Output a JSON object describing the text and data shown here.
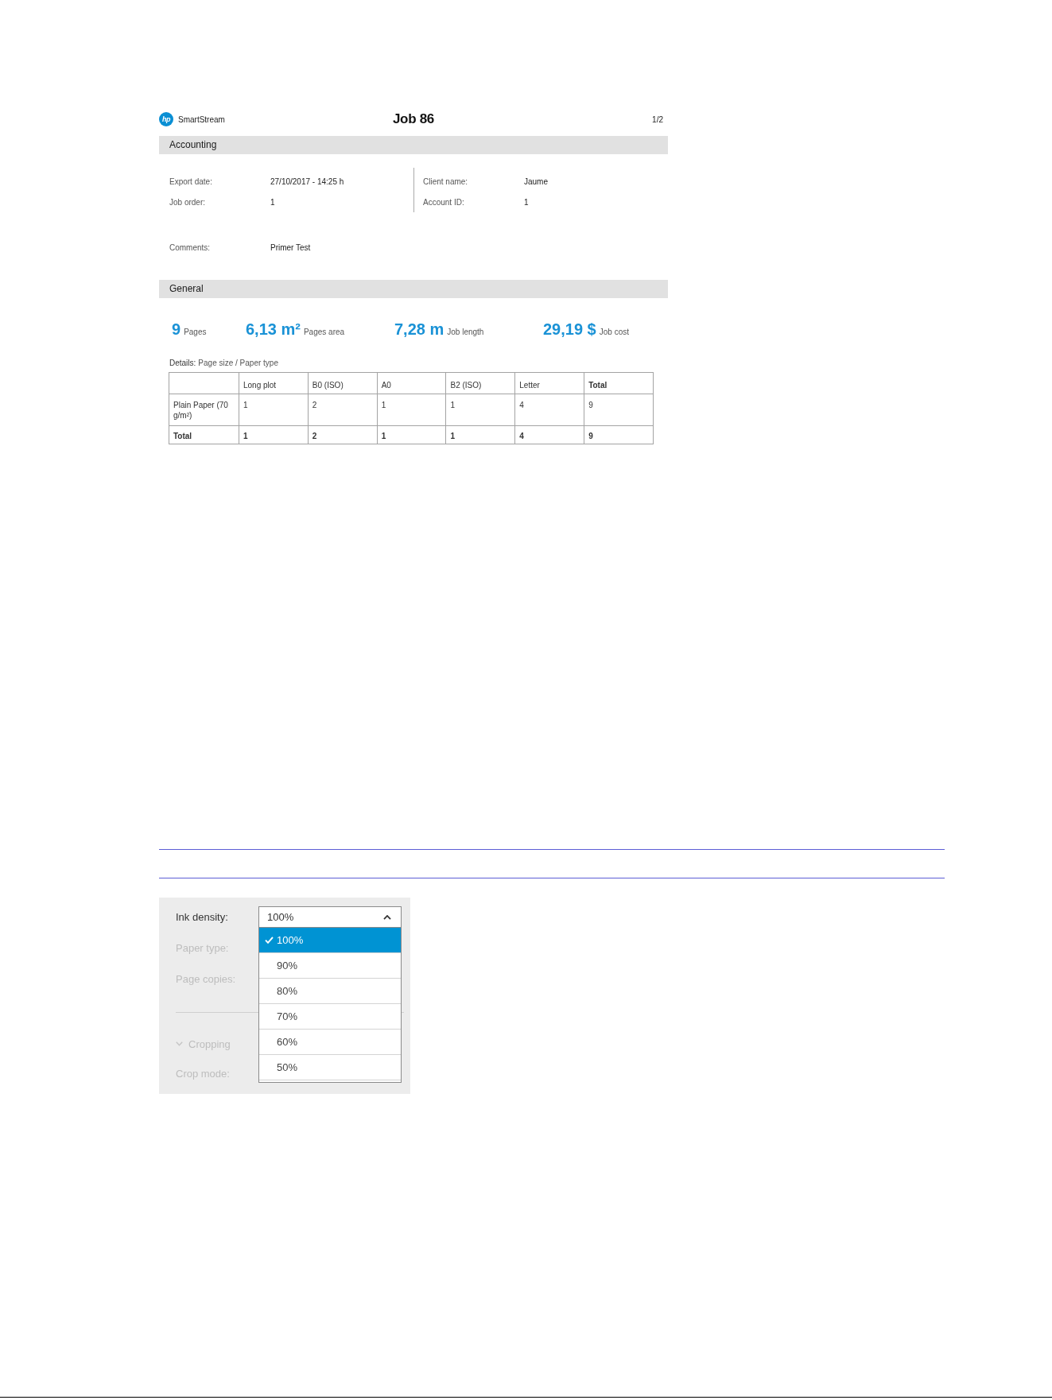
{
  "report": {
    "logo_mark": "hp",
    "brand": "SmartStream",
    "title": "Job 86",
    "page_number": "1/2",
    "accounting": {
      "heading": "Accounting",
      "left_fields": [
        {
          "label": "Export date:",
          "value": "27/10/2017 - 14:25 h"
        },
        {
          "label": "Job order:",
          "value": "1"
        }
      ],
      "right_fields": [
        {
          "label": "Client name:",
          "value": "Jaume"
        },
        {
          "label": "Account ID:",
          "value": "1"
        }
      ],
      "comments": {
        "label": "Comments:",
        "value": "Primer Test"
      }
    },
    "general": {
      "heading": "General",
      "stats": [
        {
          "value": "9",
          "label": "Pages"
        },
        {
          "value": "6,13 m²",
          "label": "Pages area"
        },
        {
          "value": "7,28 m",
          "label": "Job length"
        },
        {
          "value": "29,19 $",
          "label": "Job cost"
        }
      ],
      "details": {
        "label": "Details:",
        "text": "Page size / Paper type"
      },
      "table": {
        "columns": [
          {
            "label": "Long plot",
            "kind": "size"
          },
          {
            "label": "B0 (ISO)",
            "kind": "size"
          },
          {
            "label": "A0",
            "kind": "size"
          },
          {
            "label": "B2 (ISO)",
            "kind": "size"
          },
          {
            "label": "Letter",
            "kind": "size"
          },
          {
            "label": "Total",
            "kind": "total"
          }
        ],
        "rows": [
          {
            "kind": "paper",
            "label": "Plain Paper (70 g/m²)",
            "cells": [
              "1",
              "2",
              "1",
              "1",
              "4",
              "9"
            ]
          },
          {
            "kind": "total",
            "label": "Total",
            "cells": [
              "1",
              "2",
              "1",
              "1",
              "4",
              "9"
            ]
          }
        ]
      }
    }
  },
  "settings": {
    "rows": [
      {
        "kind": "select",
        "label": "Ink density:",
        "disabled": false,
        "dropdown": {
          "value": "100%",
          "expanded": true,
          "options": [
            {
              "label": "100%",
              "selected": true
            },
            {
              "label": "90%",
              "selected": false
            },
            {
              "label": "80%",
              "selected": false
            },
            {
              "label": "70%",
              "selected": false
            },
            {
              "label": "60%",
              "selected": false
            },
            {
              "label": "50%",
              "selected": false
            }
          ]
        }
      },
      {
        "kind": "label",
        "label": "Paper type:",
        "disabled": true
      },
      {
        "kind": "label",
        "label": "Page copies:",
        "disabled": true
      },
      {
        "kind": "section",
        "label": "Cropping",
        "disabled": true,
        "expanded": true
      },
      {
        "kind": "label",
        "label": "Crop mode:",
        "disabled": true
      }
    ]
  }
}
